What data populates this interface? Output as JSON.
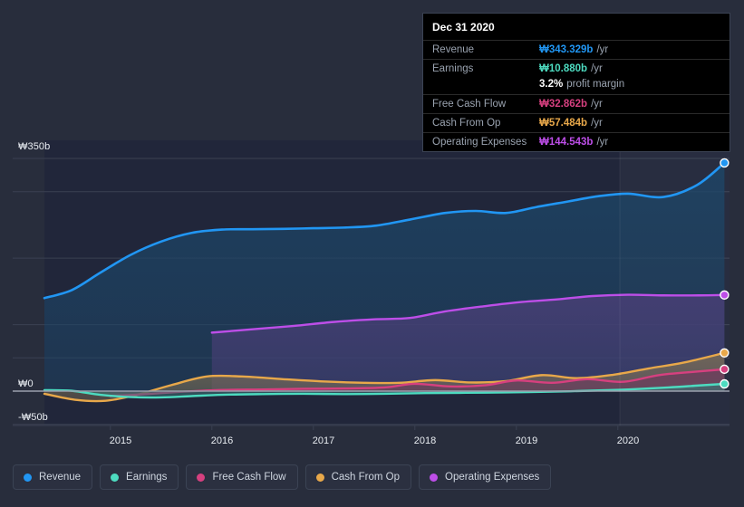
{
  "chart_data": {
    "type": "area",
    "title": "",
    "xlabel": "",
    "ylabel": "",
    "currency_symbol": "₩",
    "ylim": [
      -50,
      350
    ],
    "y_ticks": [
      350,
      0,
      -50
    ],
    "y_tick_labels": [
      "₩350b",
      "₩0",
      "-₩50b"
    ],
    "x_ticks": [
      2015,
      2016,
      2017,
      2018,
      2019,
      2020
    ],
    "x_tick_labels": [
      "2015",
      "2016",
      "2017",
      "2018",
      "2019",
      "2020"
    ],
    "xlim": [
      2014.35,
      2021.1
    ],
    "grid": true,
    "legend_position": "bottom",
    "series": [
      {
        "name": "Revenue",
        "color": "#2196f3",
        "fill": "#1d4668",
        "x": [
          2014.35,
          2014.62,
          2014.9,
          2015.2,
          2015.5,
          2015.8,
          2016.1,
          2016.4,
          2016.7,
          2017.0,
          2017.3,
          2017.62,
          2017.95,
          2018.3,
          2018.6,
          2018.9,
          2019.2,
          2019.5,
          2019.8,
          2020.1,
          2020.45,
          2020.78,
          2021.05
        ],
        "values": [
          140,
          152,
          178,
          205,
          225,
          238,
          243,
          243.5,
          244,
          245,
          246,
          249,
          258,
          268,
          271,
          268,
          277,
          285,
          293,
          297,
          292,
          310,
          343.329
        ]
      },
      {
        "name": "Earnings",
        "color": "#4ddbc0",
        "fill": "#3c6f72",
        "x": [
          2014.35,
          2014.62,
          2014.9,
          2015.2,
          2015.5,
          2015.8,
          2016.1,
          2016.5,
          2016.9,
          2017.3,
          2017.7,
          2018.1,
          2018.5,
          2018.9,
          2019.3,
          2019.7,
          2020.1,
          2020.5,
          2020.8,
          2021.05
        ],
        "values": [
          1.5,
          0.5,
          -5.5,
          -9,
          -9.5,
          -7.5,
          -5.5,
          -4.5,
          -4,
          -4.5,
          -4,
          -3,
          -2.5,
          -2,
          -1,
          0.5,
          2.5,
          5.5,
          8.5,
          10.88
        ]
      },
      {
        "name": "Free Cash Flow",
        "color": "#d6407f",
        "fill": "#6e3a5d",
        "x": [
          2015.0,
          2015.3,
          2015.7,
          2016.05,
          2016.5,
          2016.9,
          2017.3,
          2017.7,
          2018.0,
          2018.35,
          2018.7,
          2019.0,
          2019.35,
          2019.7,
          2020.05,
          2020.4,
          2020.75,
          2021.05
        ],
        "values": [
          -7.5,
          -5,
          -1,
          1.5,
          2.5,
          3.5,
          4,
          5.5,
          11,
          7,
          9,
          16,
          12.5,
          18,
          14,
          24,
          29,
          32.862
        ]
      },
      {
        "name": "Cash From Op",
        "color": "#e8a84a",
        "fill": "#7c6e54",
        "x": [
          2014.35,
          2014.65,
          2014.95,
          2015.25,
          2015.6,
          2015.95,
          2016.3,
          2016.7,
          2017.1,
          2017.5,
          2017.85,
          2018.2,
          2018.55,
          2018.9,
          2019.25,
          2019.6,
          2019.95,
          2020.3,
          2020.65,
          2021.05
        ],
        "values": [
          -4,
          -13,
          -14.5,
          -6,
          9,
          22,
          22,
          18,
          14.5,
          12.5,
          12.5,
          16.5,
          13,
          15,
          24,
          19.5,
          24.5,
          34,
          43,
          57.484
        ]
      },
      {
        "name": "Operating Expenses",
        "color": "#bd4ee8",
        "fill": "#4b3f78",
        "x": [
          2016.0,
          2016.4,
          2016.8,
          2017.2,
          2017.6,
          2017.95,
          2018.3,
          2018.7,
          2019.05,
          2019.4,
          2019.75,
          2020.1,
          2020.45,
          2020.8,
          2021.05
        ],
        "values": [
          88,
          93,
          98,
          104,
          108,
          110,
          120,
          128,
          134,
          138,
          143,
          145,
          144,
          144,
          144.543
        ]
      }
    ],
    "highlight_region": {
      "from": 2020.02,
      "to": 2021.1,
      "label": "forecast-highlight"
    },
    "end_markers": true
  },
  "tooltip": {
    "date": "Dec 31 2020",
    "rows": [
      {
        "name": "Revenue",
        "value": "₩343.329b",
        "unit": "/yr",
        "color": "#2196f3"
      },
      {
        "name": "Earnings",
        "value": "₩10.880b",
        "unit": "/yr",
        "color": "#4ddbc0"
      },
      {
        "name": "Free Cash Flow",
        "value": "₩32.862b",
        "unit": "/yr",
        "color": "#d6407f"
      },
      {
        "name": "Cash From Op",
        "value": "₩57.484b",
        "unit": "/yr",
        "color": "#e8a84a"
      },
      {
        "name": "Operating Expenses",
        "value": "₩144.543b",
        "unit": "/yr",
        "color": "#bd4ee8"
      }
    ],
    "profit_margin_value": "3.2%",
    "profit_margin_label": "profit margin"
  },
  "legend": {
    "items": [
      {
        "label": "Revenue",
        "color": "#2196f3"
      },
      {
        "label": "Earnings",
        "color": "#4ddbc0"
      },
      {
        "label": "Free Cash Flow",
        "color": "#d6407f"
      },
      {
        "label": "Cash From Op",
        "color": "#e8a84a"
      },
      {
        "label": "Operating Expenses",
        "color": "#bd4ee8"
      }
    ]
  },
  "theme": {
    "background": "#282d3c",
    "plot_background": "#21263a",
    "grid_color": "#3a4052",
    "zero_line_color": "#9aa0ad",
    "text_color": "#e9edf2"
  }
}
